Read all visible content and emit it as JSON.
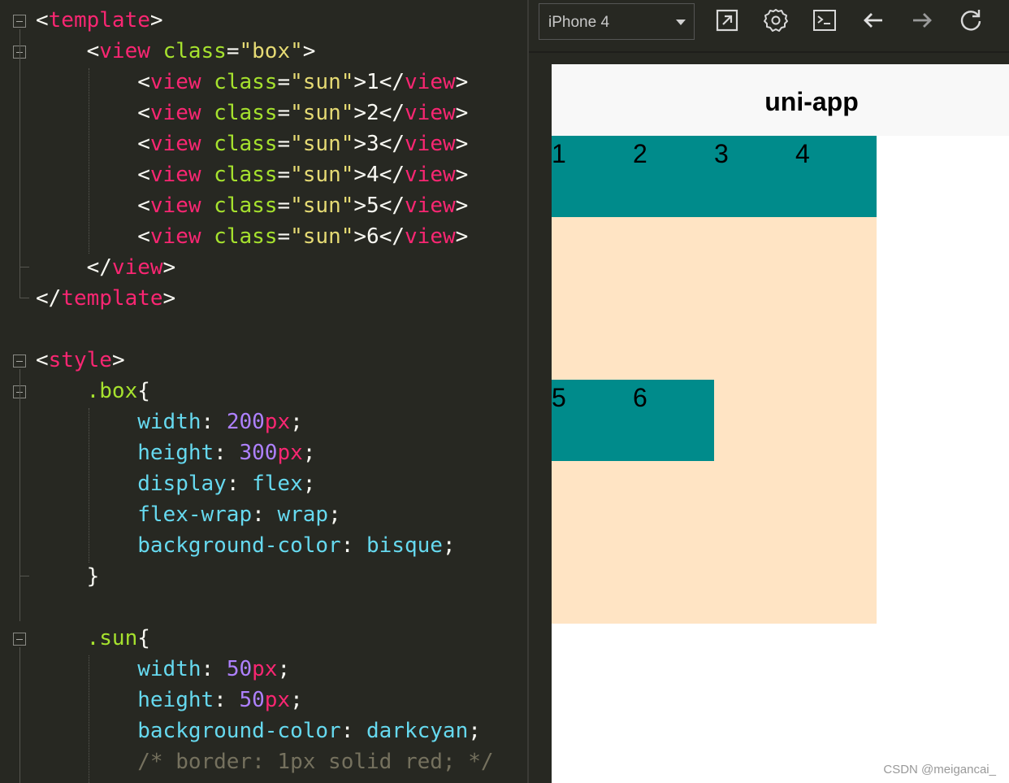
{
  "editor": {
    "lines": [
      [
        [
          "<",
          "t-punc"
        ],
        [
          "template",
          "t-tag"
        ],
        [
          ">",
          "t-punc"
        ]
      ],
      [
        [
          "    <",
          "t-punc"
        ],
        [
          "view",
          "t-tag"
        ],
        [
          " ",
          "t-punc"
        ],
        [
          "class",
          "t-attr"
        ],
        [
          "=",
          "t-punc"
        ],
        [
          "\"box\"",
          "t-str"
        ],
        [
          ">",
          "t-punc"
        ]
      ],
      [
        [
          "        <",
          "t-punc"
        ],
        [
          "view",
          "t-tag"
        ],
        [
          " ",
          "t-punc"
        ],
        [
          "class",
          "t-attr"
        ],
        [
          "=",
          "t-punc"
        ],
        [
          "\"sun\"",
          "t-str"
        ],
        [
          ">1</",
          "t-punc"
        ],
        [
          "view",
          "t-tag"
        ],
        [
          ">",
          "t-punc"
        ]
      ],
      [
        [
          "        <",
          "t-punc"
        ],
        [
          "view",
          "t-tag"
        ],
        [
          " ",
          "t-punc"
        ],
        [
          "class",
          "t-attr"
        ],
        [
          "=",
          "t-punc"
        ],
        [
          "\"sun\"",
          "t-str"
        ],
        [
          ">2</",
          "t-punc"
        ],
        [
          "view",
          "t-tag"
        ],
        [
          ">",
          "t-punc"
        ]
      ],
      [
        [
          "        <",
          "t-punc"
        ],
        [
          "view",
          "t-tag"
        ],
        [
          " ",
          "t-punc"
        ],
        [
          "class",
          "t-attr"
        ],
        [
          "=",
          "t-punc"
        ],
        [
          "\"sun\"",
          "t-str"
        ],
        [
          ">3</",
          "t-punc"
        ],
        [
          "view",
          "t-tag"
        ],
        [
          ">",
          "t-punc"
        ]
      ],
      [
        [
          "        <",
          "t-punc"
        ],
        [
          "view",
          "t-tag"
        ],
        [
          " ",
          "t-punc"
        ],
        [
          "class",
          "t-attr"
        ],
        [
          "=",
          "t-punc"
        ],
        [
          "\"sun\"",
          "t-str"
        ],
        [
          ">4</",
          "t-punc"
        ],
        [
          "view",
          "t-tag"
        ],
        [
          ">",
          "t-punc"
        ]
      ],
      [
        [
          "        <",
          "t-punc"
        ],
        [
          "view",
          "t-tag"
        ],
        [
          " ",
          "t-punc"
        ],
        [
          "class",
          "t-attr"
        ],
        [
          "=",
          "t-punc"
        ],
        [
          "\"sun\"",
          "t-str"
        ],
        [
          ">5</",
          "t-punc"
        ],
        [
          "view",
          "t-tag"
        ],
        [
          ">",
          "t-punc"
        ]
      ],
      [
        [
          "        <",
          "t-punc"
        ],
        [
          "view",
          "t-tag"
        ],
        [
          " ",
          "t-punc"
        ],
        [
          "class",
          "t-attr"
        ],
        [
          "=",
          "t-punc"
        ],
        [
          "\"sun\"",
          "t-str"
        ],
        [
          ">6</",
          "t-punc"
        ],
        [
          "view",
          "t-tag"
        ],
        [
          ">",
          "t-punc"
        ]
      ],
      [
        [
          "    </",
          "t-punc"
        ],
        [
          "view",
          "t-tag"
        ],
        [
          ">",
          "t-punc"
        ]
      ],
      [
        [
          "</",
          "t-punc"
        ],
        [
          "template",
          "t-tag"
        ],
        [
          ">",
          "t-punc"
        ]
      ],
      [],
      [
        [
          "<",
          "t-punc"
        ],
        [
          "style",
          "t-tag"
        ],
        [
          ">",
          "t-punc"
        ]
      ],
      [
        [
          "    ",
          "t-punc"
        ],
        [
          ".box",
          "t-sel"
        ],
        [
          "{",
          "t-punc"
        ]
      ],
      [
        [
          "        ",
          "t-punc"
        ],
        [
          "width",
          "t-prop"
        ],
        [
          ": ",
          "t-punc"
        ],
        [
          "200",
          "t-num"
        ],
        [
          "px",
          "t-unit"
        ],
        [
          ";",
          "t-punc"
        ]
      ],
      [
        [
          "        ",
          "t-punc"
        ],
        [
          "height",
          "t-prop"
        ],
        [
          ": ",
          "t-punc"
        ],
        [
          "300",
          "t-num"
        ],
        [
          "px",
          "t-unit"
        ],
        [
          ";",
          "t-punc"
        ]
      ],
      [
        [
          "        ",
          "t-punc"
        ],
        [
          "display",
          "t-prop"
        ],
        [
          ": ",
          "t-punc"
        ],
        [
          "flex",
          "t-prop"
        ],
        [
          ";",
          "t-punc"
        ]
      ],
      [
        [
          "        ",
          "t-punc"
        ],
        [
          "flex-wrap",
          "t-prop"
        ],
        [
          ": ",
          "t-punc"
        ],
        [
          "wrap",
          "t-prop"
        ],
        [
          ";",
          "t-punc"
        ]
      ],
      [
        [
          "        ",
          "t-punc"
        ],
        [
          "background-color",
          "t-prop"
        ],
        [
          ": ",
          "t-punc"
        ],
        [
          "bisque",
          "t-prop"
        ],
        [
          ";",
          "t-punc"
        ]
      ],
      [
        [
          "    }",
          "t-punc"
        ]
      ],
      [],
      [
        [
          "    ",
          "t-punc"
        ],
        [
          ".sun",
          "t-sel"
        ],
        [
          "{",
          "t-punc"
        ]
      ],
      [
        [
          "        ",
          "t-punc"
        ],
        [
          "width",
          "t-prop"
        ],
        [
          ": ",
          "t-punc"
        ],
        [
          "50",
          "t-num"
        ],
        [
          "px",
          "t-unit"
        ],
        [
          ";",
          "t-punc"
        ]
      ],
      [
        [
          "        ",
          "t-punc"
        ],
        [
          "height",
          "t-prop"
        ],
        [
          ": ",
          "t-punc"
        ],
        [
          "50",
          "t-num"
        ],
        [
          "px",
          "t-unit"
        ],
        [
          ";",
          "t-punc"
        ]
      ],
      [
        [
          "        ",
          "t-punc"
        ],
        [
          "background-color",
          "t-prop"
        ],
        [
          ": ",
          "t-punc"
        ],
        [
          "darkcyan",
          "t-prop"
        ],
        [
          ";",
          "t-punc"
        ]
      ],
      [
        [
          "        ",
          "t-punc"
        ],
        [
          "/* border: 1px solid red; */",
          "t-comment"
        ]
      ]
    ]
  },
  "toolbar": {
    "device": "iPhone 4",
    "icons": [
      "open-external-icon",
      "settings-icon",
      "terminal-icon",
      "back-arrow-icon",
      "forward-arrow-icon",
      "refresh-icon"
    ]
  },
  "preview": {
    "nav_title": "uni-app",
    "boxes": [
      "1",
      "2",
      "3",
      "4",
      "5",
      "6"
    ]
  },
  "watermark": "CSDN @meigancai_"
}
